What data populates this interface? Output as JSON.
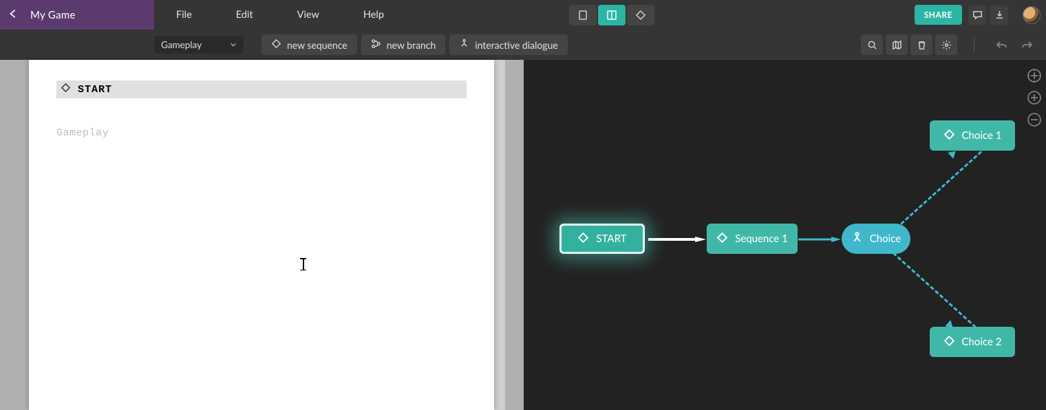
{
  "titlebar": {
    "project_name": "My Game",
    "menus": [
      "File",
      "Edit",
      "View",
      "Help"
    ],
    "share_label": "SHARE"
  },
  "toolbar": {
    "dropdown_value": "Gameplay",
    "new_sequence": "new sequence",
    "new_branch": "new branch",
    "interactive_dialogue": "interactive dialogue"
  },
  "editor": {
    "start_label": "START",
    "placeholder": "Gameplay"
  },
  "graph": {
    "start": "START",
    "sequence1": "Sequence 1",
    "choice": "Choice",
    "choice1": "Choice 1",
    "choice2": "Choice 2"
  }
}
